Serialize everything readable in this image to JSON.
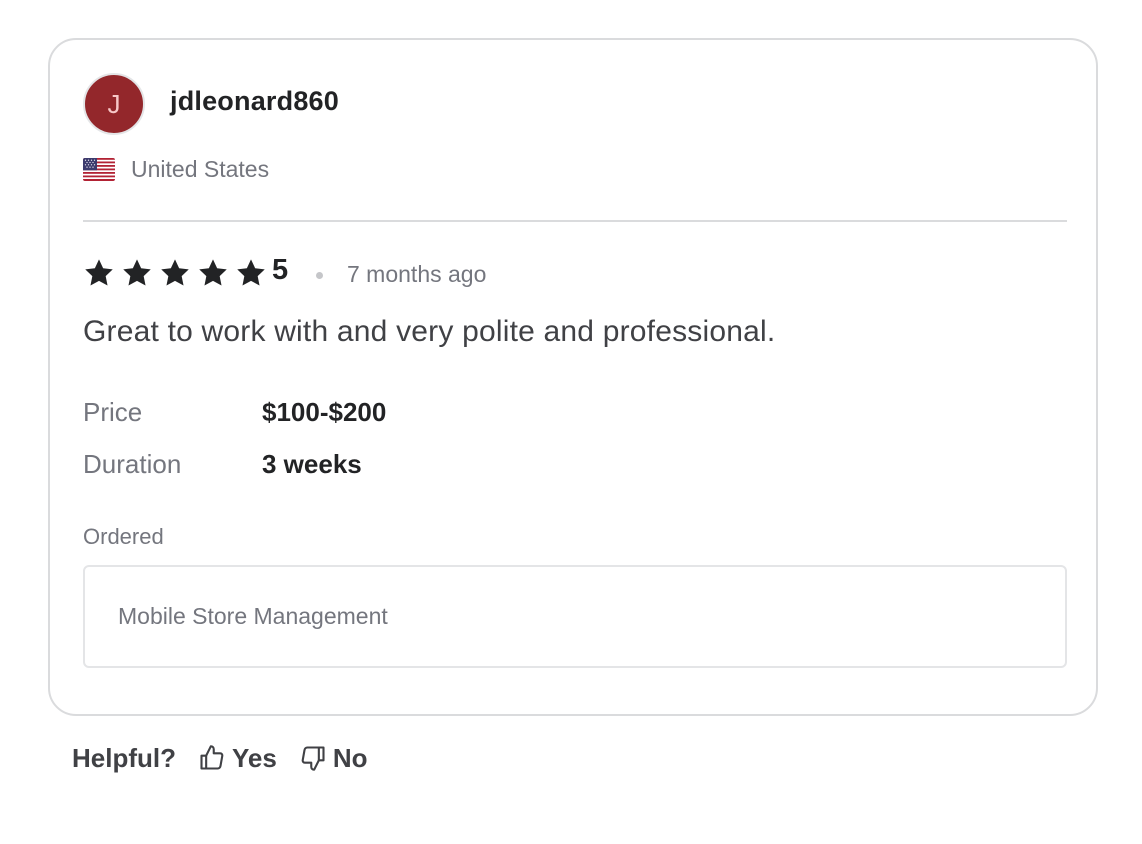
{
  "reviewer": {
    "avatar_initial": "J",
    "avatar_color": "#93272b",
    "username": "jdleonard860",
    "country_flag_icon": "us-flag-icon",
    "country": "United States"
  },
  "review": {
    "stars": 5,
    "rating": "5",
    "time_ago": "7 months ago",
    "text": "Great to work with and very polite and professional."
  },
  "details": {
    "price_label": "Price",
    "price_value": "$100-$200",
    "duration_label": "Duration",
    "duration_value": "3 weeks"
  },
  "ordered": {
    "label": "Ordered",
    "item": "Mobile Store Management"
  },
  "feedback": {
    "question": "Helpful?",
    "yes_label": "Yes",
    "yes_icon": "thumbs-up-icon",
    "no_label": "No",
    "no_icon": "thumbs-down-icon"
  },
  "colors": {
    "text_dark": "#222325",
    "text_muted": "#74767e",
    "border": "#dadbdd"
  }
}
